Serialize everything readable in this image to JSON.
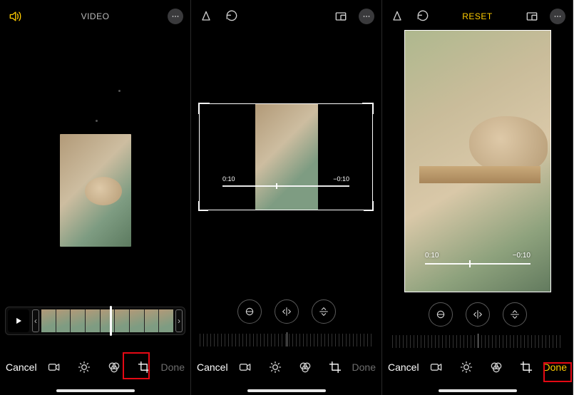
{
  "panel1": {
    "top_title": "VIDEO",
    "sound_on": true,
    "timeline": {
      "frame_count": 9
    },
    "bottom": {
      "cancel": "Cancel",
      "done": "Done"
    },
    "highlight": "crop-tool"
  },
  "panel2": {
    "top": {
      "has_skew": true,
      "has_rotate": true,
      "has_aspect": true,
      "has_more": true
    },
    "trim": {
      "left_time": "0:10",
      "right_time": "−0:10"
    },
    "controls": [
      "straighten",
      "flip-horizontal",
      "flip-vertical"
    ],
    "bottom": {
      "cancel": "Cancel",
      "done": "Done"
    }
  },
  "panel3": {
    "top_title": "RESET",
    "trim": {
      "left_time": "0:10",
      "right_time": "−0:10"
    },
    "controls": [
      "straighten",
      "flip-horizontal",
      "flip-vertical"
    ],
    "bottom": {
      "cancel": "Cancel",
      "done": "Done"
    },
    "highlight": "done-button"
  },
  "tools": {
    "video": "video-tool",
    "adjust": "adjust-tool",
    "filters": "filters-tool",
    "crop": "crop-tool"
  }
}
